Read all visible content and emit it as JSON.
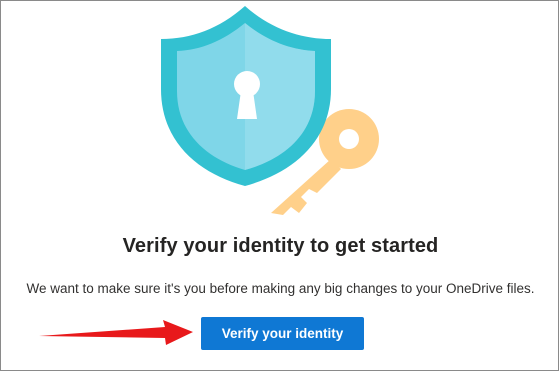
{
  "page": {
    "title": "Verify your identity to get started",
    "subtitle": "We want to make sure it's you before making any big changes to your OneDrive files.",
    "verify_button_label": "Verify your identity"
  },
  "illustration": {
    "shield_icon": "shield-icon",
    "key_icon": "key-icon",
    "keyhole_icon": "keyhole-icon"
  },
  "annotation": {
    "arrow_icon": "red-arrow-icon"
  },
  "colors": {
    "shield_outer": "#33c1d1",
    "shield_inner": "#7fd6e8",
    "key": "#ffd08a",
    "button": "#0f78d4",
    "arrow": "#e8191b"
  }
}
